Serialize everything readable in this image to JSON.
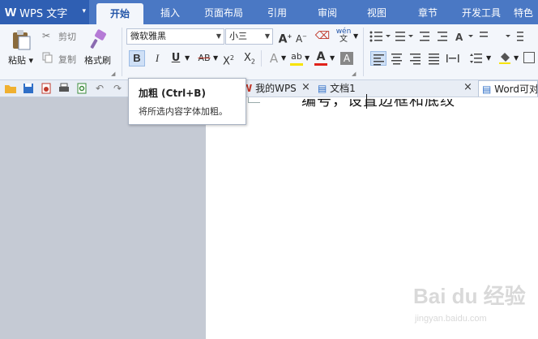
{
  "app": {
    "logo": "W",
    "name": "WPS 文字",
    "caret": "▾"
  },
  "menu_tabs": [
    "开始",
    "插入",
    "页面布局",
    "引用",
    "审阅",
    "视图",
    "章节",
    "开发工具",
    "特色"
  ],
  "ribbon": {
    "paste": "粘贴",
    "cut": "剪切",
    "copy": "复制",
    "format_painter": "格式刷",
    "font_name": "微软雅黑",
    "font_size": "小三",
    "grow_font": "A",
    "shrink_font": "A",
    "bold": "B",
    "italic": "I",
    "underline": "U",
    "strike": "AB",
    "superscript": "X",
    "subscript": "X",
    "text_effect": "A",
    "highlight": "ab",
    "font_color": "A",
    "char_shading": "A",
    "phonetic": "wén",
    "accent_color": "#4a78c4",
    "font_color_bar": "#e0221a",
    "highlight_bar": "#f7e300"
  },
  "tabs": [
    {
      "label": "我的WPS",
      "close": "×"
    },
    {
      "label": "文档1",
      "close": "×"
    },
    {
      "label": "Word可对"
    }
  ],
  "tooltip": {
    "title": "加粗 (Ctrl+B)",
    "desc": "将所选内容字体加粗。"
  },
  "document": {
    "visible_text": "编号，设置边框和底纹"
  },
  "watermark": {
    "main": "Bai du 经验",
    "sub": "jingyan.baidu.com"
  }
}
